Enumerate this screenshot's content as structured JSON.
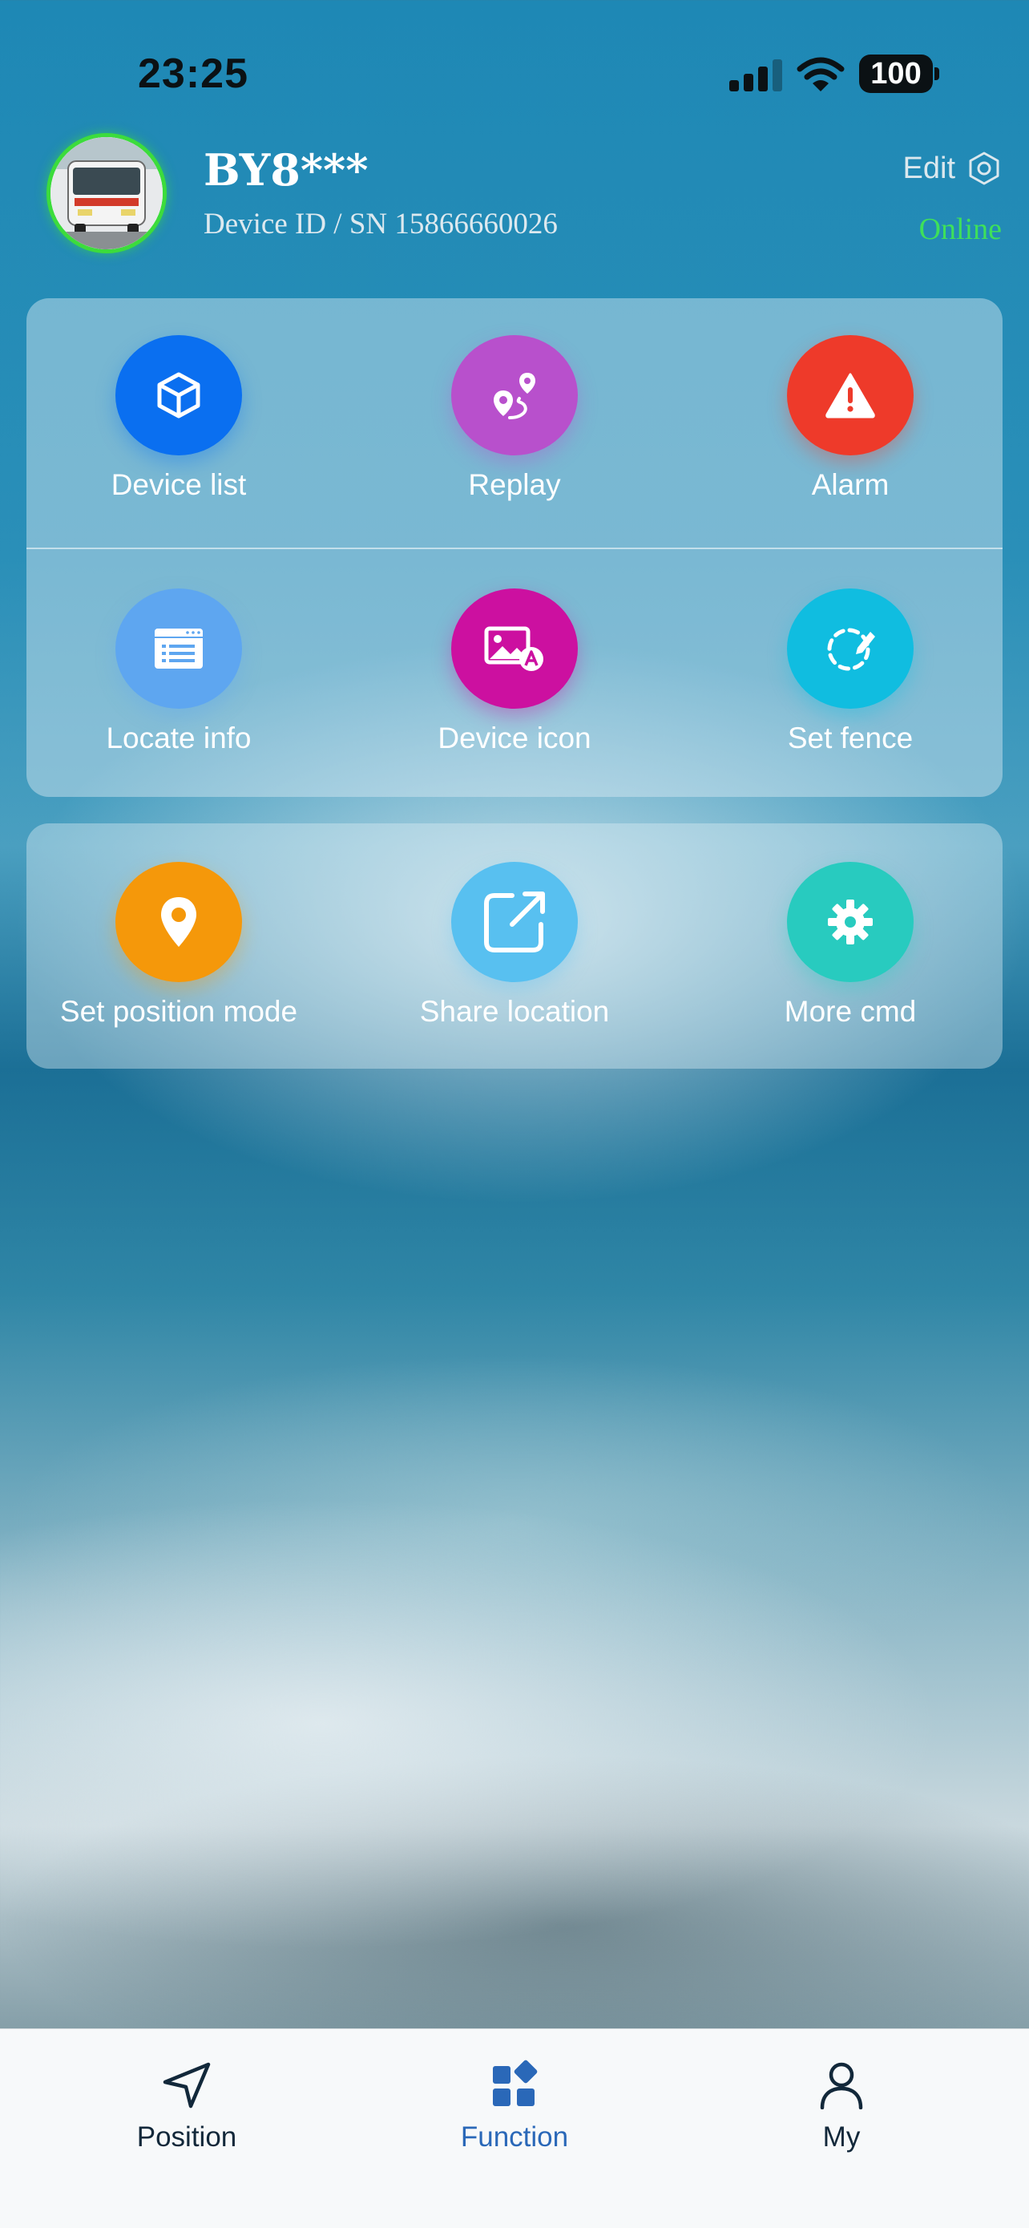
{
  "status_bar": {
    "time": "23:25",
    "battery": "100"
  },
  "device": {
    "name": "BY8***",
    "id_line": "Device ID / SN 15866660026",
    "edit_label": "Edit",
    "status": "Online"
  },
  "functions": {
    "group1": [
      {
        "label": "Device list",
        "icon": "cube-icon",
        "color": "#0a6ff0"
      },
      {
        "label": "Replay",
        "icon": "route-pin-icon",
        "color": "#b850cc"
      },
      {
        "label": "Alarm",
        "icon": "warning-icon",
        "color": "#ee3a2a"
      },
      {
        "label": "Locate info",
        "icon": "info-window-icon",
        "color": "#5ea6f0"
      },
      {
        "label": "Device icon",
        "icon": "image-edit-icon",
        "color": "#cc10a0"
      },
      {
        "label": "Set fence",
        "icon": "fence-pencil-icon",
        "color": "#10bde0"
      }
    ],
    "group2": [
      {
        "label": "Set position mode",
        "icon": "location-pin-icon",
        "color": "#f5980a"
      },
      {
        "label": "Share location",
        "icon": "share-external-icon",
        "color": "#58c0f0"
      },
      {
        "label": "More cmd",
        "icon": "gear-icon",
        "color": "#28cbbf"
      }
    ]
  },
  "tabbar": {
    "tabs": [
      {
        "label": "Position",
        "icon": "navigation-arrow-icon",
        "active": false
      },
      {
        "label": "Function",
        "icon": "grid-icon",
        "active": true
      },
      {
        "label": "My",
        "icon": "user-icon",
        "active": false
      }
    ],
    "active_color": "#2a68b8",
    "inactive_color": "#12283a"
  }
}
